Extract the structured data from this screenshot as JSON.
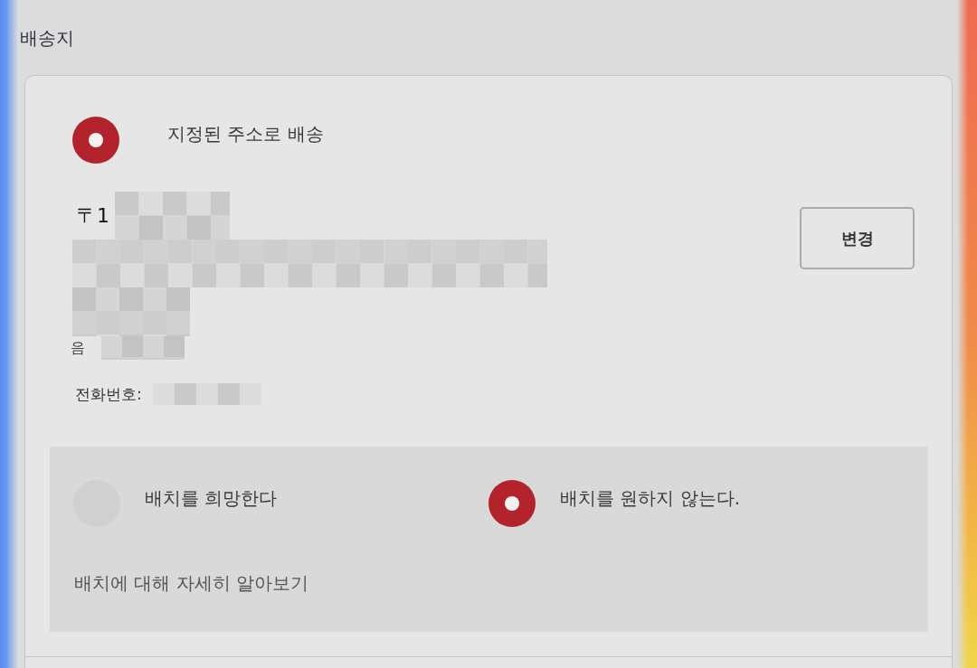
{
  "header": {
    "title": "배송지"
  },
  "delivery_option": {
    "label": "지정된 주소로 배송",
    "selected": true
  },
  "address": {
    "postal_code": "〒1",
    "partial_line": "음",
    "phone_label": "전화번호:"
  },
  "change_button": {
    "label": "변경"
  },
  "placement": {
    "options": [
      {
        "label": "배치를 희망한다",
        "selected": false
      },
      {
        "label": "배치를 원하지 않는다.",
        "selected": true
      }
    ],
    "link": "배치에 대해 자세히 알아보기"
  }
}
